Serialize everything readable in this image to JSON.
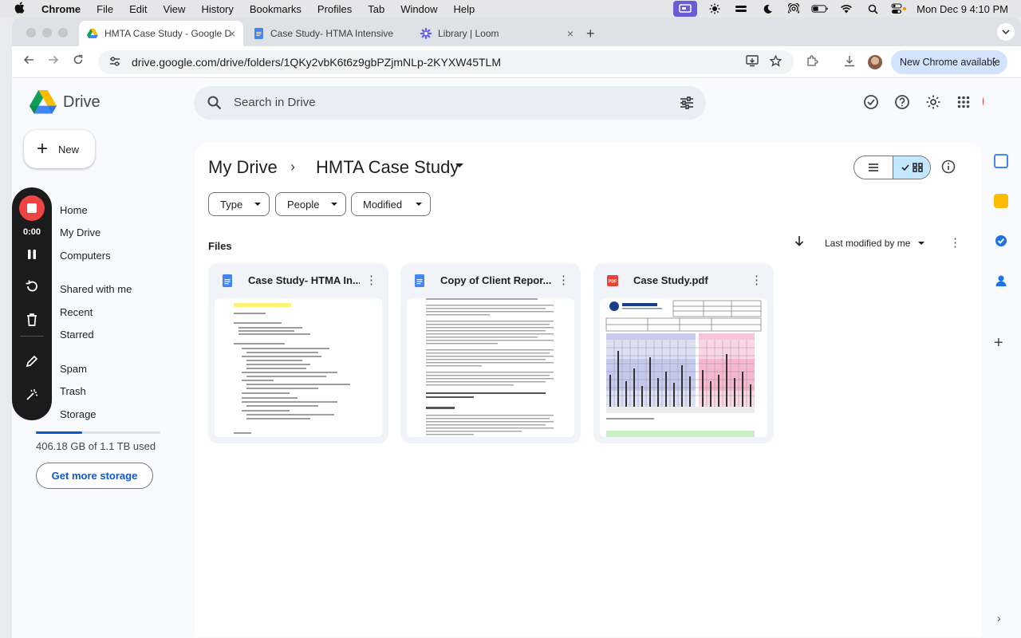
{
  "menubar": {
    "apple": "",
    "items": [
      "Chrome",
      "File",
      "Edit",
      "View",
      "History",
      "Bookmarks",
      "Profiles",
      "Tab",
      "Window",
      "Help"
    ],
    "clock": "Mon Dec 9  4:10 PM"
  },
  "tabs": [
    {
      "title": "HMTA Case Study - Google D",
      "icon": "drive-icon",
      "active": true
    },
    {
      "title": "Case Study- HTMA Intensive",
      "icon": "docs-icon",
      "active": false
    },
    {
      "title": "Library | Loom",
      "icon": "loom-icon",
      "active": false
    }
  ],
  "omnibox": {
    "url": "drive.google.com/drive/folders/1QKy2vbK6t6z9gbPZjmNLp-2KYXW45TLM"
  },
  "new_chrome_label": "New Chrome available",
  "drive": {
    "product_name": "Drive",
    "search_placeholder": "Search in Drive",
    "new_button_label": "New",
    "nav": [
      {
        "label": "Home"
      },
      {
        "label": "My Drive"
      },
      {
        "label": "Computers"
      },
      {
        "label": "Shared with me"
      },
      {
        "label": "Recent"
      },
      {
        "label": "Starred"
      },
      {
        "label": "Spam"
      },
      {
        "label": "Trash"
      },
      {
        "label": "Storage"
      }
    ],
    "storage": {
      "text": "406.18 GB of 1.1 TB used",
      "used_fraction": 0.37,
      "button": "Get more storage"
    },
    "breadcrumb": {
      "root": "My Drive",
      "separator": "›",
      "current": "HMTA Case Study"
    },
    "filters": [
      "Type",
      "People",
      "Modified"
    ],
    "files_label": "Files",
    "sort_label": "Last modified by me",
    "files": [
      {
        "name": "Case Study- HTMA In...",
        "type": "docs"
      },
      {
        "name": "Copy of Client Repor...",
        "type": "docs"
      },
      {
        "name": "Case Study.pdf",
        "type": "pdf"
      }
    ],
    "pdf_badge": "PDF"
  },
  "loom": {
    "timer": "0:00"
  },
  "colors": {
    "drive_blue": "#0b57d0",
    "docs_blue": "#4285f4",
    "pdf_red": "#ea4335",
    "loom_stop": "#ef4444",
    "selected_view": "#c2e7ff"
  }
}
